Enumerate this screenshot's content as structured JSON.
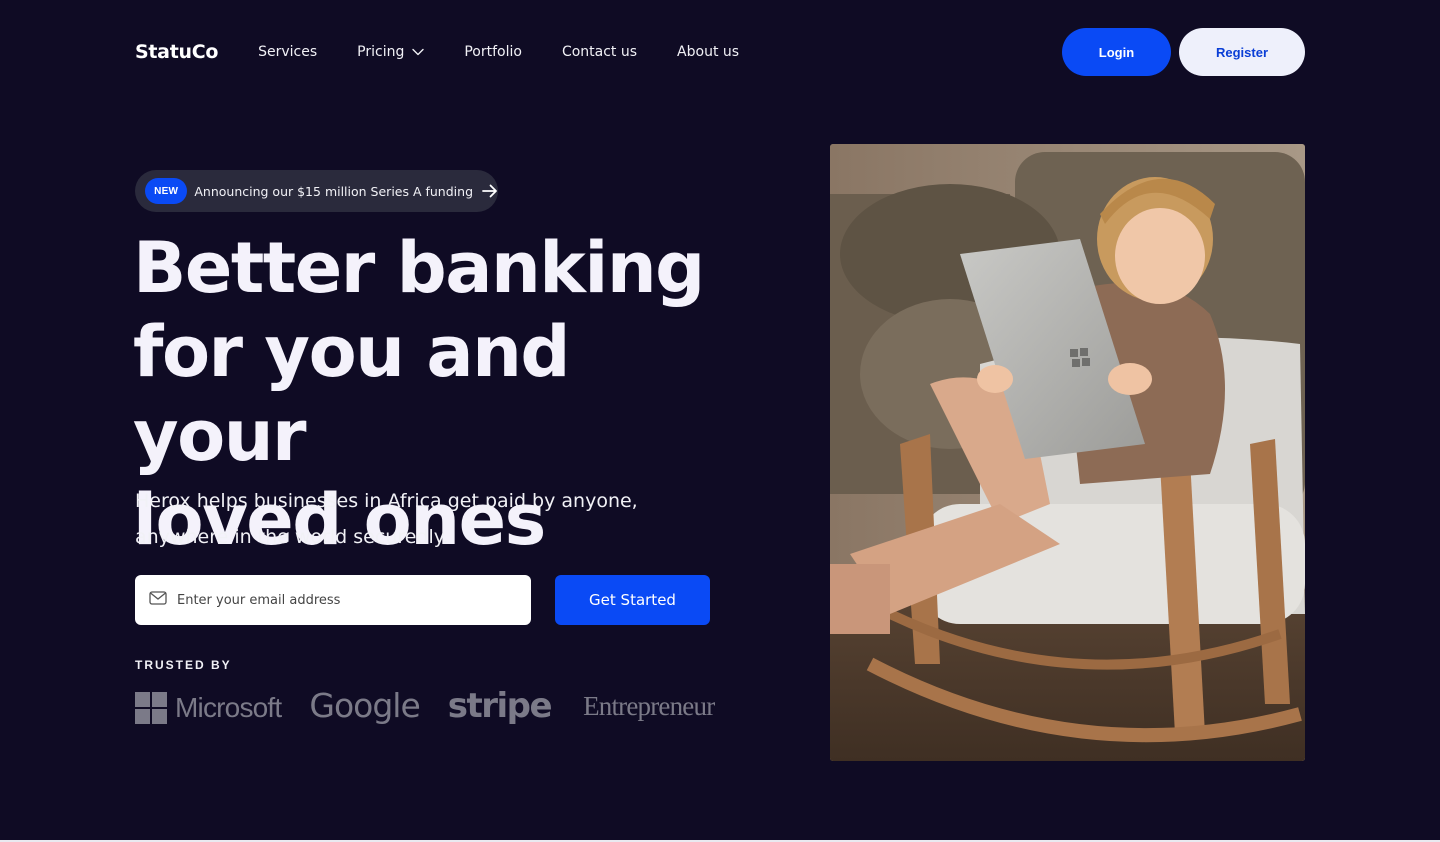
{
  "nav": {
    "logo": "StatuCo",
    "links": [
      {
        "label": "Services"
      },
      {
        "label": "Pricing",
        "has_dropdown": true
      },
      {
        "label": "Portfolio"
      },
      {
        "label": "Contact us"
      },
      {
        "label": "About us"
      }
    ],
    "login_label": "Login",
    "register_label": "Register"
  },
  "hero": {
    "badge": "NEW",
    "announcement": "Announcing our $15 million Series A funding",
    "title_lines": [
      "Better banking",
      "for you and your",
      "loved ones"
    ],
    "subtitle_lines": [
      "Herox helps businesses in Africa get paid by anyone,",
      "anywhere in the world securedly."
    ],
    "email_placeholder": "Enter your email address",
    "cta_label": "Get Started",
    "trusted_label": "TRUSTED BY",
    "trusted_logos": [
      "Microsoft",
      "Google",
      "stripe",
      "Entrepreneur"
    ]
  },
  "colors": {
    "background": "#0f0b24",
    "accent": "#0a4af5",
    "register_bg": "#eef0fb",
    "logo_gray": "#7b7a88"
  },
  "icons": {
    "pricing_dropdown": "chevron-down-icon",
    "announcement_arrow": "arrow-right-icon",
    "email": "mail-icon"
  }
}
